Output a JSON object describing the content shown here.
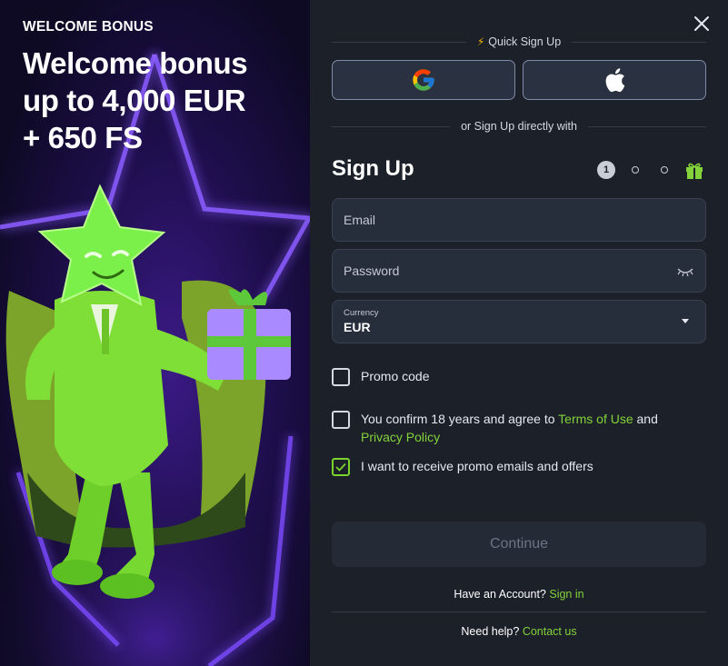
{
  "promo": {
    "kicker": "WELCOME BONUS",
    "headline_line1": "Welcome bonus",
    "headline_line2": "up to 4,000 EUR",
    "headline_line3": "+ 650 FS",
    "mascot": "green-star-mascot-with-gift"
  },
  "form": {
    "quick_signup_label": "Quick Sign Up",
    "social": [
      {
        "name": "google",
        "icon": "google-icon"
      },
      {
        "name": "apple",
        "icon": "apple-icon"
      }
    ],
    "direct_label": "or Sign Up directly with",
    "title": "Sign Up",
    "steps": {
      "current": "1",
      "total_dots": 2,
      "gift_icon": "gift-icon"
    },
    "email_placeholder": "Email",
    "password_placeholder": "Password",
    "currency_label": "Currency",
    "currency_value": "EUR",
    "promo_code_label": "Promo code",
    "promo_code_checked": false,
    "age_text_before": "You confirm 18 years and agree to ",
    "terms_link": "Terms of Use",
    "age_text_and": " and",
    "privacy_link": "Privacy Policy",
    "age_checked": false,
    "promo_emails_label": "I want to receive promo emails and offers",
    "promo_emails_checked": true,
    "continue_label": "Continue",
    "have_account_text": "Have an Account?",
    "sign_in_link": "Sign in",
    "need_help_text": "Need help?",
    "contact_link": "Contact us"
  },
  "colors": {
    "accent_green": "#84d33a",
    "panel_bg": "#1b2029",
    "field_bg": "#272e3b",
    "bolt": "#f5b301"
  }
}
